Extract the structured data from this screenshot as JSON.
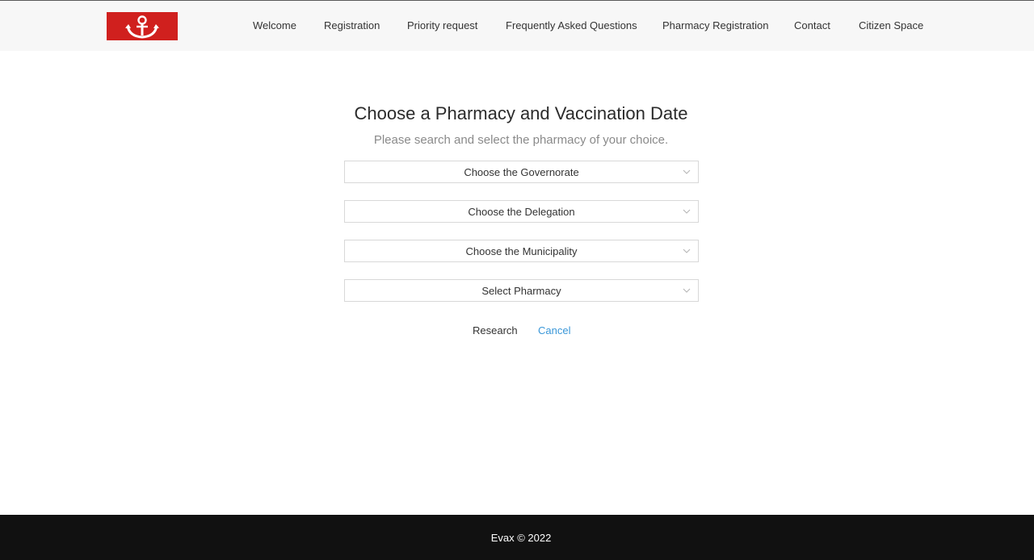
{
  "nav": {
    "items": [
      {
        "label": "Welcome"
      },
      {
        "label": "Registration"
      },
      {
        "label": "Priority request"
      },
      {
        "label": "Frequently Asked Questions"
      },
      {
        "label": "Pharmacy Registration"
      },
      {
        "label": "Contact"
      },
      {
        "label": "Citizen Space"
      }
    ]
  },
  "main": {
    "title": "Choose a Pharmacy and Vaccination Date",
    "subtitle": "Please search and select the pharmacy of your choice.",
    "selects": [
      {
        "value": "Choose the Governorate"
      },
      {
        "value": "Choose the Delegation"
      },
      {
        "value": "Choose the Municipality"
      },
      {
        "value": "Select Pharmacy"
      }
    ],
    "research_label": "Research",
    "cancel_label": "Cancel"
  },
  "footer": {
    "text": "Evax © 2022"
  },
  "colors": {
    "brand_red": "#d0201e",
    "link_blue": "#3a97d8",
    "footer_bg": "#111111"
  },
  "icons": {
    "logo": "anchor-logo-icon",
    "select_arrow": "chevron-down-icon"
  }
}
